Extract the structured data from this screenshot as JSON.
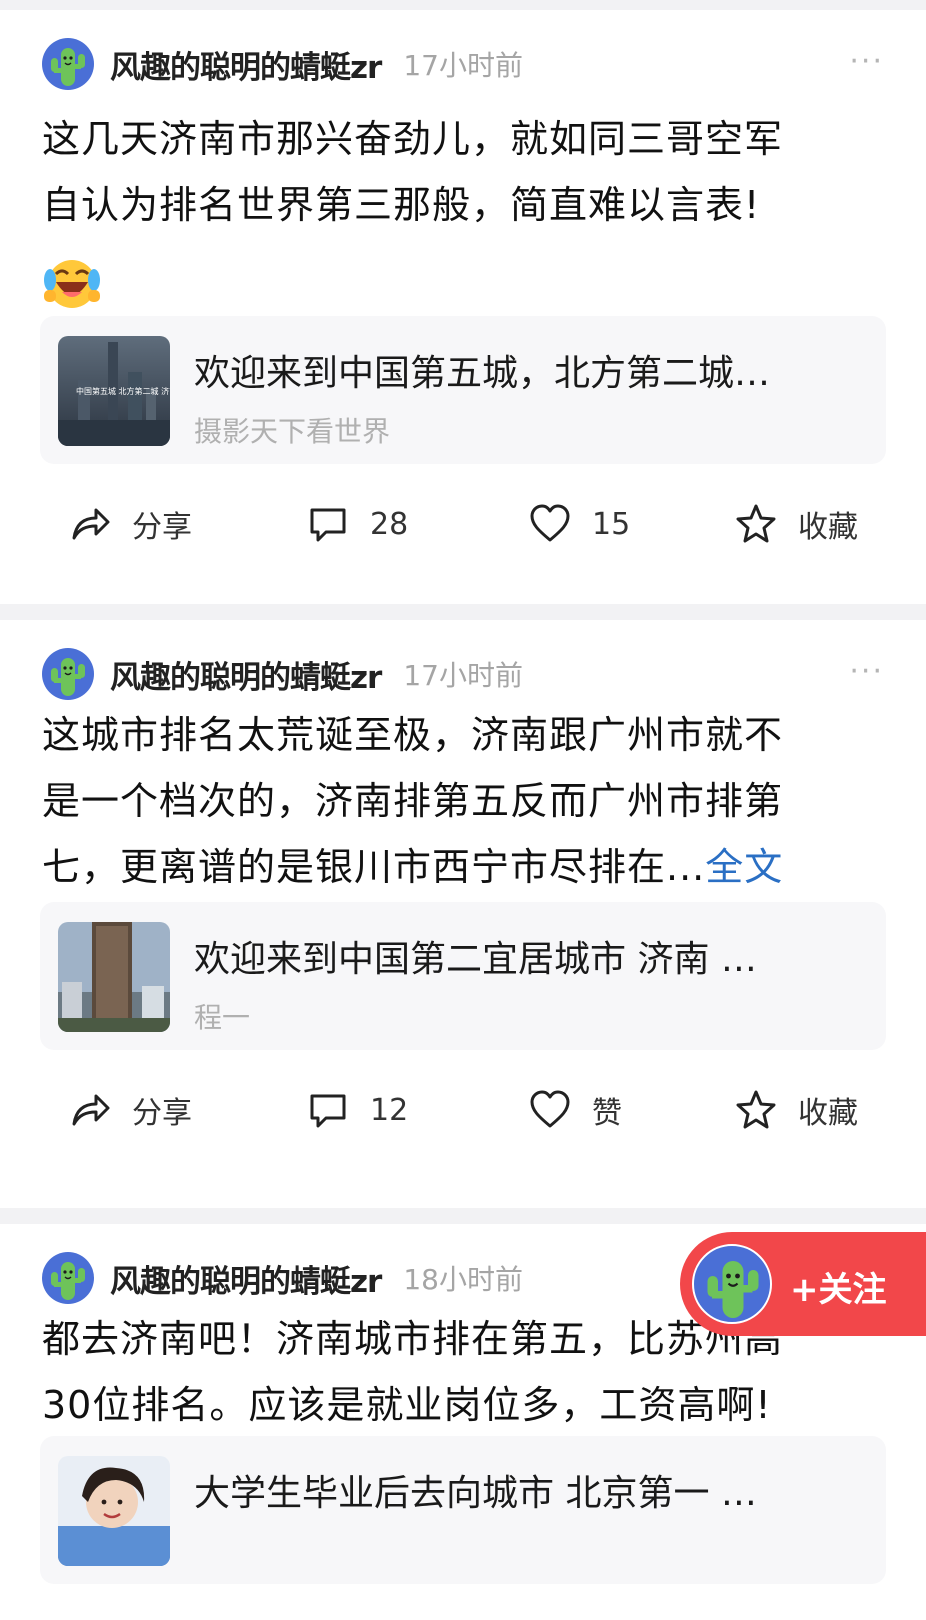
{
  "posts": [
    {
      "author": "风趣的聪明的蜻蜓zr",
      "time": "17小时前",
      "more": "···",
      "text_lines": [
        "这几天济南市那兴奋劲儿，就如同三哥空军",
        "自认为排名世界第三那般，简直难以言表!"
      ],
      "emoji": "laughing-crying-emoji",
      "share": {
        "title": "欢迎来到中国第五城，北方第二城…",
        "source": "摄影天下看世界",
        "thumb_text": "中国第五城 北方第二城 济南"
      },
      "actions": {
        "share": "分享",
        "comments": "28",
        "likes": "15",
        "favorite": "收藏"
      }
    },
    {
      "author": "风趣的聪明的蜻蜓zr",
      "time": "17小时前",
      "more": "···",
      "text_lines": [
        "这城市排名太荒诞至极，济南跟广州市就不",
        "是一个档次的，济南排第五反而广州市排第",
        "七，更离谱的是银川市西宁市尽排在..."
      ],
      "full_text_link": "全文",
      "share": {
        "title": "欢迎来到中国第二宜居城市 济南 …",
        "source": "程一"
      },
      "actions": {
        "share": "分享",
        "comments": "12",
        "likes": "赞",
        "favorite": "收藏"
      }
    },
    {
      "author": "风趣的聪明的蜻蜓zr",
      "time": "18小时前",
      "text_lines": [
        "都去济南吧！济南城市排在第五，比苏州高",
        "30位排名。应该是就业岗位多，工资高啊!"
      ],
      "share": {
        "title": "大学生毕业后去向城市 北京第一 …",
        "source": ""
      }
    }
  ],
  "follow_button": {
    "label": "+关注"
  },
  "colors": {
    "accent": "#f2474a",
    "link": "#2a6fc4",
    "avatar_bg": "#4a6fd6",
    "cactus": "#6ec35a"
  }
}
